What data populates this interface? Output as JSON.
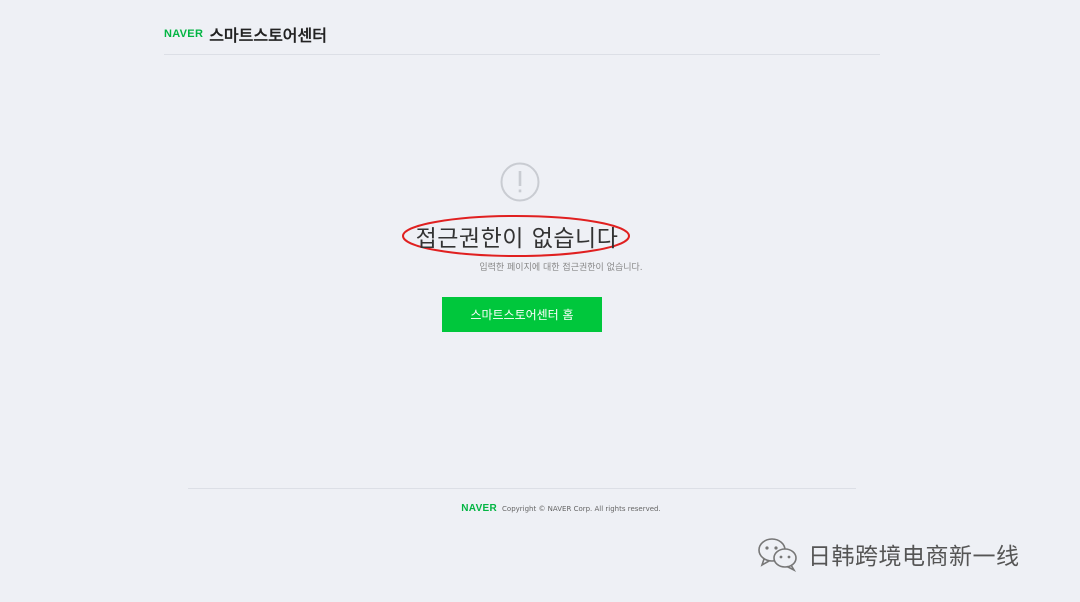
{
  "header": {
    "logo": "NAVER",
    "title": "스마트스토어센터"
  },
  "error": {
    "title": "접근권한이 없습니다",
    "description": "입력한 페이지에 대한 접근권한이 없습니다.",
    "home_button_label": "스마트스토어센터 홈"
  },
  "footer": {
    "logo": "NAVER",
    "copyright": "Copyright © NAVER Corp. All rights reserved."
  },
  "watermark": {
    "text": "日韩跨境电商新一线"
  },
  "colors": {
    "background": "#eef0f5",
    "brand_green": "#03b543",
    "button_green": "#00c73c",
    "annotation_red": "#e02020"
  }
}
